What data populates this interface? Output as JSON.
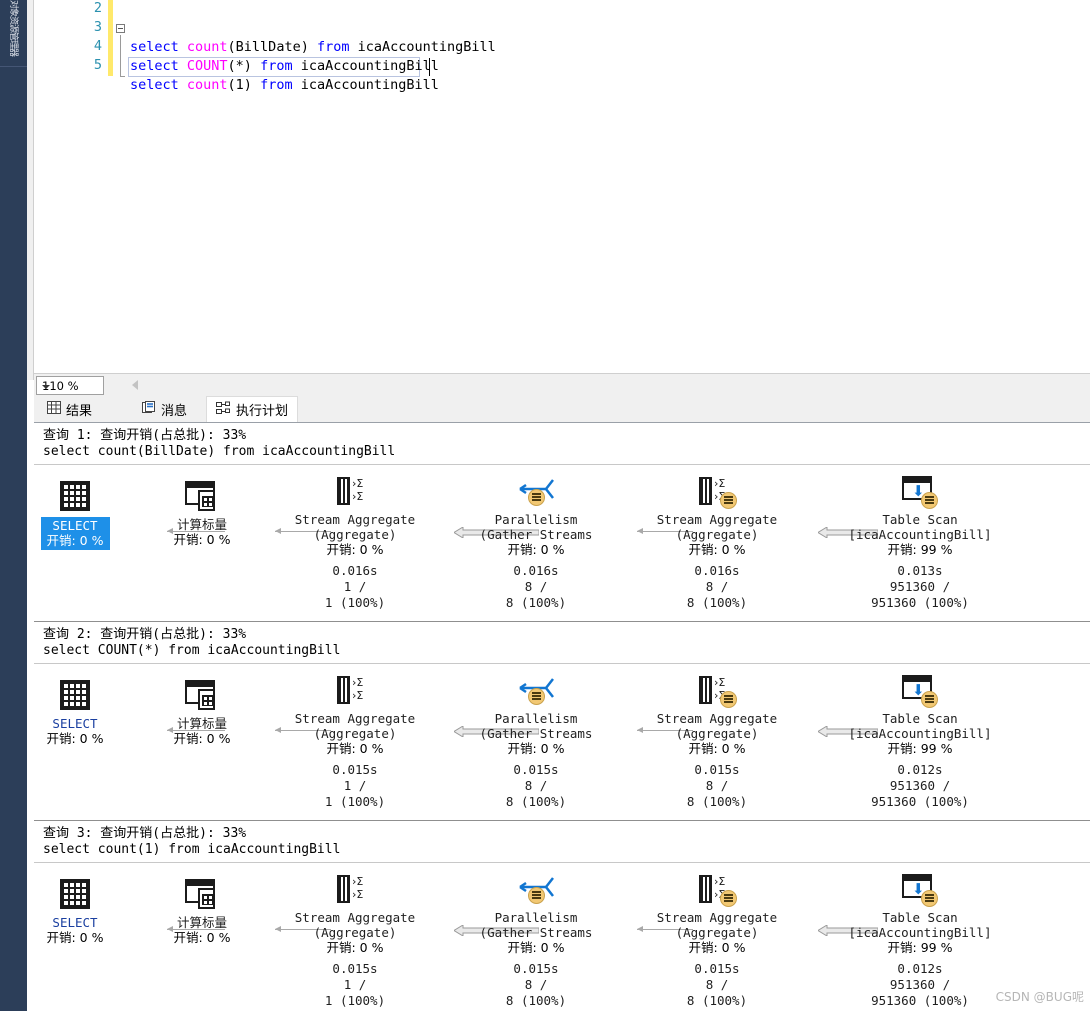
{
  "sidebar": {
    "collapsed_tab_label": "对象资源管理器"
  },
  "editor": {
    "zoom_level": "110 %",
    "lines": [
      {
        "number": "2",
        "text": ""
      },
      {
        "number": "3",
        "text": "select count(BillDate) from icaAccountingBill"
      },
      {
        "number": "4",
        "text": "select COUNT(*) from icaAccountingBill"
      },
      {
        "number": "5",
        "text": "select count(1) from icaAccountingBill"
      }
    ]
  },
  "result_tabs": [
    {
      "label": "结果",
      "icon": "grid-icon",
      "active": false
    },
    {
      "label": "消息",
      "icon": "message-icon",
      "active": false
    },
    {
      "label": "执行计划",
      "icon": "plan-icon",
      "active": true
    }
  ],
  "queries": [
    {
      "header": "查询 1: 查询开销(占总批): 33%",
      "header_prefix": "查询",
      "header_index": "1",
      "header_mid": ": 查询开销(占总批): ",
      "header_cost": "33%",
      "sql": "select count(BillDate) from icaAccountingBill",
      "nodes": [
        {
          "icon": "select-icon",
          "title": "SELECT",
          "subtitle": "",
          "cost": "开销: 0 %",
          "time": "",
          "rows": "",
          "rowpct": "",
          "selected": true
        },
        {
          "icon": "compute-scalar-icon",
          "title": "计算标量",
          "subtitle": "",
          "cost": "开销: 0 %",
          "time": "",
          "rows": "",
          "rowpct": "",
          "selected": false
        },
        {
          "icon": "stream-aggregate-icon",
          "title": "Stream Aggregate",
          "subtitle": "(Aggregate)",
          "cost": "开销: 0 %",
          "time": "0.016s",
          "rows": "1 /",
          "rowpct": "1 (100%)",
          "selected": false
        },
        {
          "icon": "parallelism-icon",
          "title": "Parallelism",
          "subtitle": "(Gather Streams",
          "cost": "开销: 0 %",
          "time": "0.016s",
          "rows": "8 /",
          "rowpct": "8 (100%)",
          "selected": false
        },
        {
          "icon": "stream-aggregate-parallel-icon",
          "title": "Stream Aggregate",
          "subtitle": "(Aggregate)",
          "cost": "开销: 0 %",
          "time": "0.016s",
          "rows": "8 /",
          "rowpct": "8 (100%)",
          "selected": false
        },
        {
          "icon": "table-scan-icon",
          "title": "Table Scan",
          "subtitle": "[icaAccountingBill]",
          "cost": "开销: 99 %",
          "time": "0.013s",
          "rows": "951360 /",
          "rowpct": "951360 (100%)",
          "selected": false
        }
      ]
    },
    {
      "header": "查询 2: 查询开销(占总批): 33%",
      "header_prefix": "查询",
      "header_index": "2",
      "header_mid": ": 查询开销(占总批): ",
      "header_cost": "33%",
      "sql": "select COUNT(*) from icaAccountingBill",
      "nodes": [
        {
          "icon": "select-icon",
          "title": "SELECT",
          "subtitle": "",
          "cost": "开销: 0 %",
          "time": "",
          "rows": "",
          "rowpct": "",
          "selected": false
        },
        {
          "icon": "compute-scalar-icon",
          "title": "计算标量",
          "subtitle": "",
          "cost": "开销: 0 %",
          "time": "",
          "rows": "",
          "rowpct": "",
          "selected": false
        },
        {
          "icon": "stream-aggregate-icon",
          "title": "Stream Aggregate",
          "subtitle": "(Aggregate)",
          "cost": "开销: 0 %",
          "time": "0.015s",
          "rows": "1 /",
          "rowpct": "1 (100%)",
          "selected": false
        },
        {
          "icon": "parallelism-icon",
          "title": "Parallelism",
          "subtitle": "(Gather Streams",
          "cost": "开销: 0 %",
          "time": "0.015s",
          "rows": "8 /",
          "rowpct": "8 (100%)",
          "selected": false
        },
        {
          "icon": "stream-aggregate-parallel-icon",
          "title": "Stream Aggregate",
          "subtitle": "(Aggregate)",
          "cost": "开销: 0 %",
          "time": "0.015s",
          "rows": "8 /",
          "rowpct": "8 (100%)",
          "selected": false
        },
        {
          "icon": "table-scan-icon",
          "title": "Table Scan",
          "subtitle": "[icaAccountingBill]",
          "cost": "开销: 99 %",
          "time": "0.012s",
          "rows": "951360 /",
          "rowpct": "951360 (100%)",
          "selected": false
        }
      ]
    },
    {
      "header": "查询 3: 查询开销(占总批): 33%",
      "header_prefix": "查询",
      "header_index": "3",
      "header_mid": ": 查询开销(占总批): ",
      "header_cost": "33%",
      "sql": "select count(1) from icaAccountingBill",
      "nodes": [
        {
          "icon": "select-icon",
          "title": "SELECT",
          "subtitle": "",
          "cost": "开销: 0 %",
          "time": "",
          "rows": "",
          "rowpct": "",
          "selected": false
        },
        {
          "icon": "compute-scalar-icon",
          "title": "计算标量",
          "subtitle": "",
          "cost": "开销: 0 %",
          "time": "",
          "rows": "",
          "rowpct": "",
          "selected": false
        },
        {
          "icon": "stream-aggregate-icon",
          "title": "Stream Aggregate",
          "subtitle": "(Aggregate)",
          "cost": "开销: 0 %",
          "time": "0.015s",
          "rows": "1 /",
          "rowpct": "1 (100%)",
          "selected": false
        },
        {
          "icon": "parallelism-icon",
          "title": "Parallelism",
          "subtitle": "(Gather Streams",
          "cost": "开销: 0 %",
          "time": "0.015s",
          "rows": "8 /",
          "rowpct": "8 (100%)",
          "selected": false
        },
        {
          "icon": "stream-aggregate-parallel-icon",
          "title": "Stream Aggregate",
          "subtitle": "(Aggregate)",
          "cost": "开销: 0 %",
          "time": "0.015s",
          "rows": "8 /",
          "rowpct": "8 (100%)",
          "selected": false
        },
        {
          "icon": "table-scan-icon",
          "title": "Table Scan",
          "subtitle": "[icaAccountingBill]",
          "cost": "开销: 99 %",
          "time": "0.012s",
          "rows": "951360 /",
          "rowpct": "951360 (100%)",
          "selected": false
        }
      ]
    }
  ],
  "watermark": "CSDN @BUG呢",
  "colors": {
    "selection_blue": "#1e90e8",
    "keyword_blue": "#0000ff",
    "function_magenta": "#ff00ff",
    "linenum_teal": "#2b91af",
    "rail_navy": "#2c3e59",
    "changebar_yellow": "#ffe96b"
  }
}
